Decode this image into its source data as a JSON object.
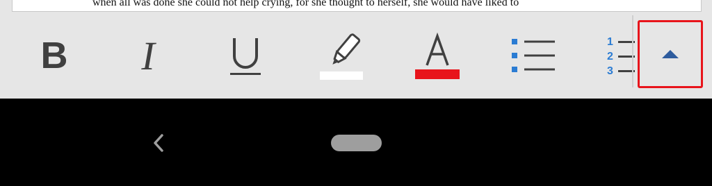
{
  "document": {
    "visible_line": "when all was done she could not help crying, for she thought to herself, she would have liked to"
  },
  "toolbar": {
    "bold_label": "B",
    "italic_label": "I",
    "underline_label": "U",
    "font_color_letter": "A",
    "highlight_color": "#ffffff",
    "font_color": "#e8141b",
    "list_accent_color": "#2b7cd3",
    "numbered_list_digits": [
      "1",
      "2",
      "3"
    ],
    "expand_icon": "caret-up-icon",
    "selection_outline_color": "#e8141b"
  },
  "navbar": {
    "back_icon": "back-chevron-icon",
    "home_icon": "home-pill-icon"
  }
}
